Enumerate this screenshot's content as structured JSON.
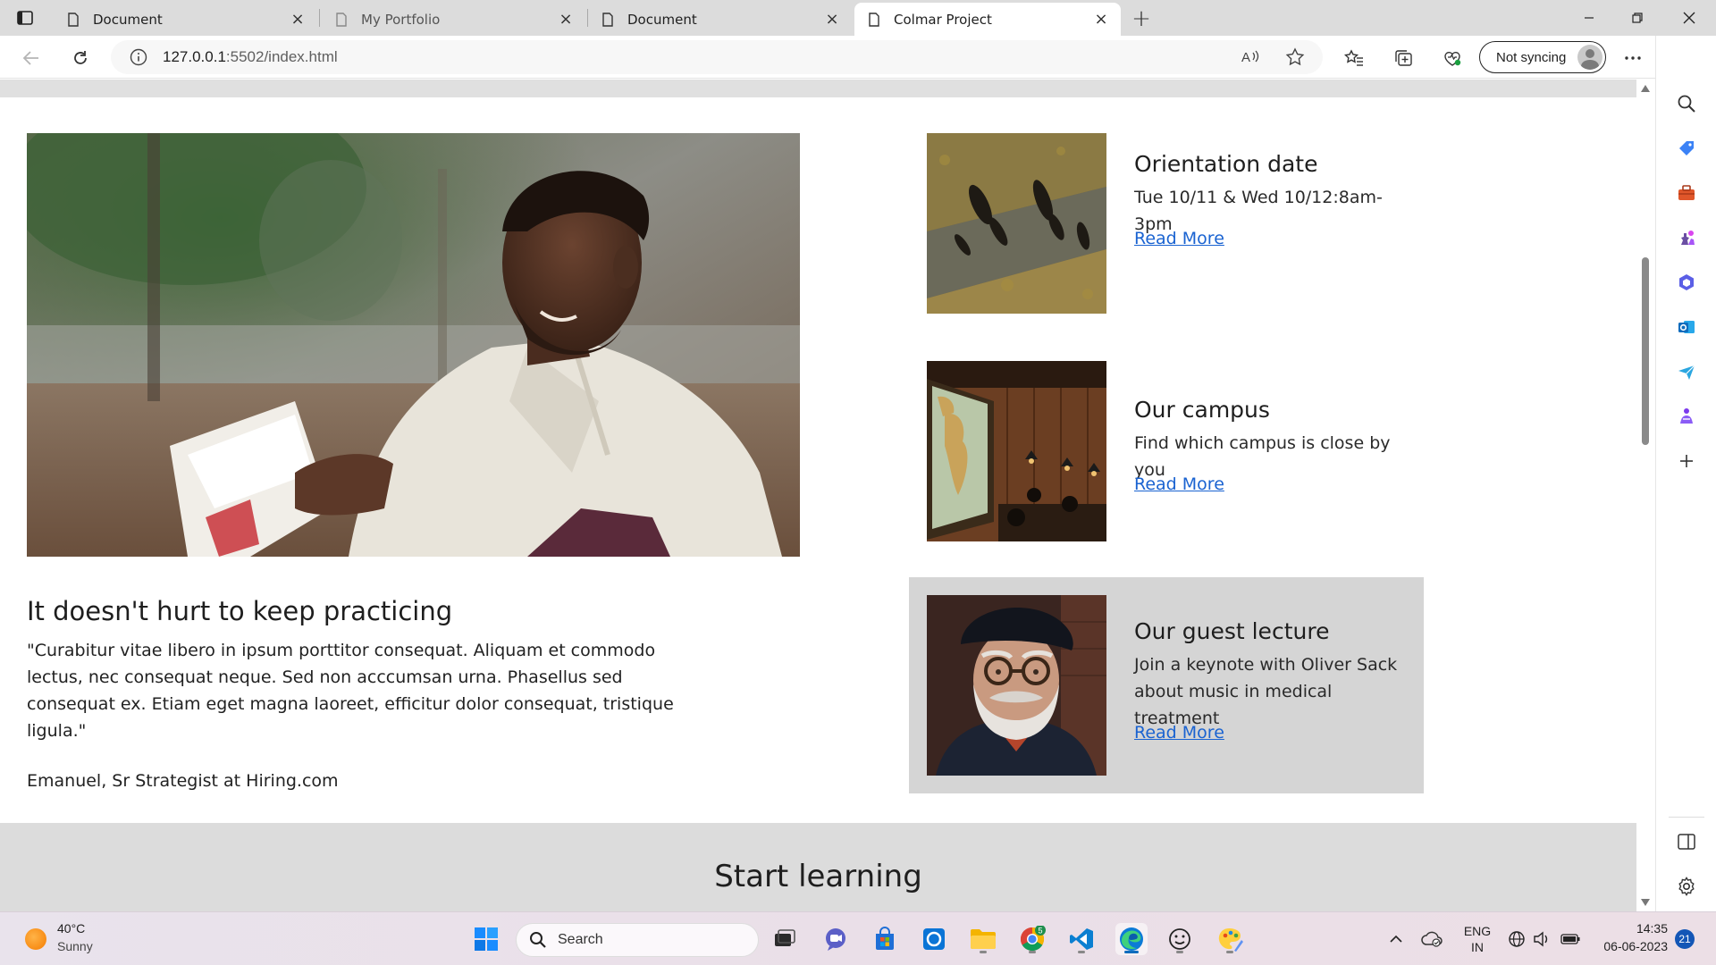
{
  "browser": {
    "tabs": [
      {
        "title": "Document",
        "active": false
      },
      {
        "title": "My Portfolio",
        "active": false
      },
      {
        "title": "Document",
        "active": false
      },
      {
        "title": "Colmar Project",
        "active": true
      }
    ],
    "address": {
      "host": "127.0.0.1",
      "rest": ":5502/index.html"
    },
    "sync_label": "Not syncing"
  },
  "page": {
    "testimonial": {
      "title": "It doesn't hurt to keep practicing",
      "quote": "\"Curabitur vitae libero in ipsum porttitor consequat. Aliquam et commodo lectus, nec consequat neque. Sed non acccumsan urna. Phasellus sed consequat ex. Etiam eget magna laoreet, efficitur dolor consequat, tristique ligula.\"",
      "author": "Emanuel, Sr Strategist at Hiring.com"
    },
    "cards": [
      {
        "title": "Orientation date",
        "text": "Tue 10/11 & Wed 10/12:8am-3pm",
        "link": "Read More"
      },
      {
        "title": "Our campus",
        "text": "Find which campus is close by you",
        "link": "Read More"
      },
      {
        "title": "Our guest lecture",
        "text": "Join a keynote with Oliver Sack about music in medical treatment",
        "link": "Read More"
      }
    ],
    "learn_title": "Start learning"
  },
  "taskbar": {
    "weather": {
      "temp": "40°C",
      "condition": "Sunny"
    },
    "search_label": "Search",
    "chrome_badge": "5",
    "lang": {
      "line1": "ENG",
      "line2": "IN"
    },
    "clock": {
      "time": "14:35",
      "date": "06-06-2023"
    },
    "notifications": "21"
  },
  "colors": {
    "accent": "#0f6cbd",
    "link": "#1a63d1",
    "card_highlight": "#d5d5d5",
    "band": "#dcdcdc"
  }
}
